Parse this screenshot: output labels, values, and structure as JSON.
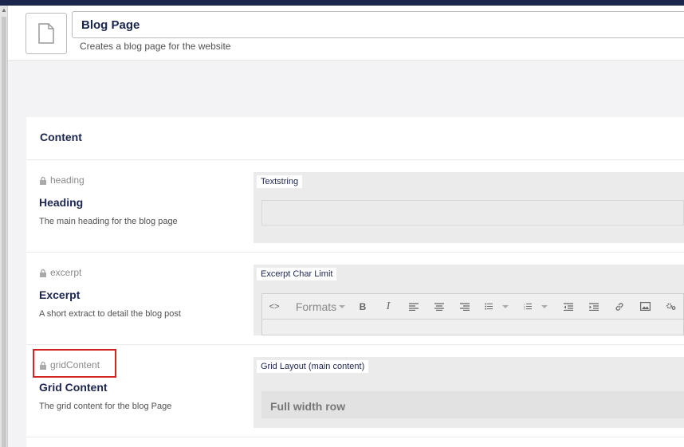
{
  "header": {
    "name": "Blog Page",
    "description": "Creates a blog page for the website"
  },
  "content_card": {
    "title": "Content"
  },
  "properties": [
    {
      "alias": "heading",
      "label": "Heading",
      "description": "The main heading for the blog page",
      "editor_tag": "Textstring",
      "value": ""
    },
    {
      "alias": "excerpt",
      "label": "Excerpt",
      "description": "A short extract to detail the blog post",
      "editor_tag": "Excerpt Char Limit",
      "toolbar": {
        "formats_label": "Formats",
        "bold": "B",
        "italic": "I"
      }
    },
    {
      "alias": "gridContent",
      "label": "Grid Content",
      "description": "The grid content for the blog Page",
      "editor_tag": "Grid Layout (main content)",
      "row_label": "Full width row"
    }
  ],
  "colors": {
    "topbar": "#1b264f",
    "text_primary": "#1b264f",
    "highlight": "#d42525"
  },
  "icons": [
    "document-icon",
    "lock-icon",
    "code-icon",
    "bold-icon",
    "italic-icon",
    "align-left-icon",
    "align-center-icon",
    "align-right-icon",
    "bullet-list-icon",
    "numbered-list-icon",
    "outdent-icon",
    "indent-icon",
    "link-icon",
    "image-icon",
    "macro-icon"
  ]
}
